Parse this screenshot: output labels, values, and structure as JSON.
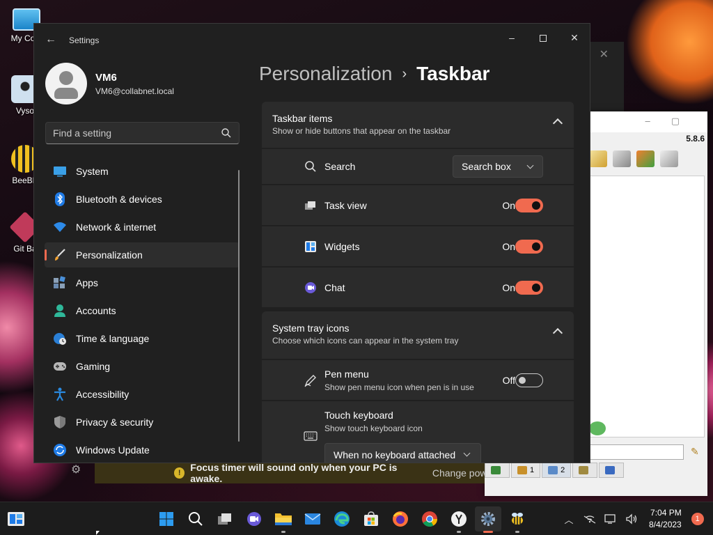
{
  "desktop": {
    "icons": [
      {
        "name": "my-computer",
        "label": "My Com"
      },
      {
        "name": "vysor",
        "label": "Vyso"
      },
      {
        "name": "beebeep",
        "label": "BeeBE"
      },
      {
        "name": "git-bash",
        "label": "Git Ba"
      }
    ]
  },
  "background_app": {
    "version": "5.8.6",
    "tabs": [
      {
        "name": "tab-1",
        "label": ""
      },
      {
        "name": "tab-2",
        "label": "1"
      },
      {
        "name": "tab-3",
        "label": "2"
      },
      {
        "name": "tab-4",
        "label": ""
      },
      {
        "name": "tab-5",
        "label": ""
      }
    ]
  },
  "focus_notification": {
    "message": "Focus timer will sound only when your PC is awake.",
    "action": "Change pow"
  },
  "settings": {
    "app_title": "Settings",
    "window_controls": {
      "minimize": "–",
      "close": "✕"
    },
    "user": {
      "name": "VM6",
      "email": "VM6@collabnet.local"
    },
    "search": {
      "placeholder": "Find a setting",
      "value": ""
    },
    "nav": [
      {
        "label": "System",
        "icon": "monitor-icon",
        "active": false
      },
      {
        "label": "Bluetooth & devices",
        "icon": "bluetooth-icon",
        "active": false
      },
      {
        "label": "Network & internet",
        "icon": "wifi-icon",
        "active": false
      },
      {
        "label": "Personalization",
        "icon": "brush-icon",
        "active": true
      },
      {
        "label": "Apps",
        "icon": "apps-icon",
        "active": false
      },
      {
        "label": "Accounts",
        "icon": "person-icon",
        "active": false
      },
      {
        "label": "Time & language",
        "icon": "globe-clock-icon",
        "active": false
      },
      {
        "label": "Gaming",
        "icon": "gamepad-icon",
        "active": false
      },
      {
        "label": "Accessibility",
        "icon": "accessibility-icon",
        "active": false
      },
      {
        "label": "Privacy & security",
        "icon": "shield-icon",
        "active": false
      },
      {
        "label": "Windows Update",
        "icon": "sync-icon",
        "active": false
      }
    ],
    "breadcrumb": {
      "parent": "Personalization",
      "separator": "›",
      "current": "Taskbar"
    },
    "taskbar_items": {
      "title": "Taskbar items",
      "description": "Show or hide buttons that appear on the taskbar",
      "search": {
        "label": "Search",
        "value": "Search box"
      },
      "rows": [
        {
          "label": "Task view",
          "state": "On"
        },
        {
          "label": "Widgets",
          "state": "On"
        },
        {
          "label": "Chat",
          "state": "On"
        }
      ]
    },
    "system_tray": {
      "title": "System tray icons",
      "description": "Choose which icons can appear in the system tray",
      "pen_menu": {
        "label": "Pen menu",
        "description": "Show pen menu icon when pen is in use",
        "state": "Off"
      },
      "touch_keyboard": {
        "label": "Touch keyboard",
        "description": "Show touch keyboard icon",
        "value": "When no keyboard attached"
      }
    }
  },
  "taskbar": {
    "apps": [
      {
        "name": "start",
        "icon": "windows-logo-icon"
      },
      {
        "name": "search",
        "icon": "search-icon"
      },
      {
        "name": "task-view",
        "icon": "task-view-icon"
      },
      {
        "name": "chat",
        "icon": "chat-icon"
      },
      {
        "name": "file-explorer",
        "icon": "folder-icon"
      },
      {
        "name": "mail",
        "icon": "mail-icon"
      },
      {
        "name": "edge",
        "icon": "edge-icon"
      },
      {
        "name": "store",
        "icon": "store-icon"
      },
      {
        "name": "firefox",
        "icon": "firefox-icon"
      },
      {
        "name": "chrome",
        "icon": "chrome-icon"
      },
      {
        "name": "yandex",
        "icon": "yandex-icon"
      },
      {
        "name": "settings",
        "icon": "gear-icon"
      },
      {
        "name": "beebeep",
        "icon": "bee-icon"
      }
    ],
    "clock": {
      "time": "7:04 PM",
      "date": "8/4/2023"
    },
    "notification_count": "1",
    "colors": {
      "accent": "#f06a4f",
      "window_bg": "#202020",
      "card_bg": "#2b2b2b"
    }
  }
}
